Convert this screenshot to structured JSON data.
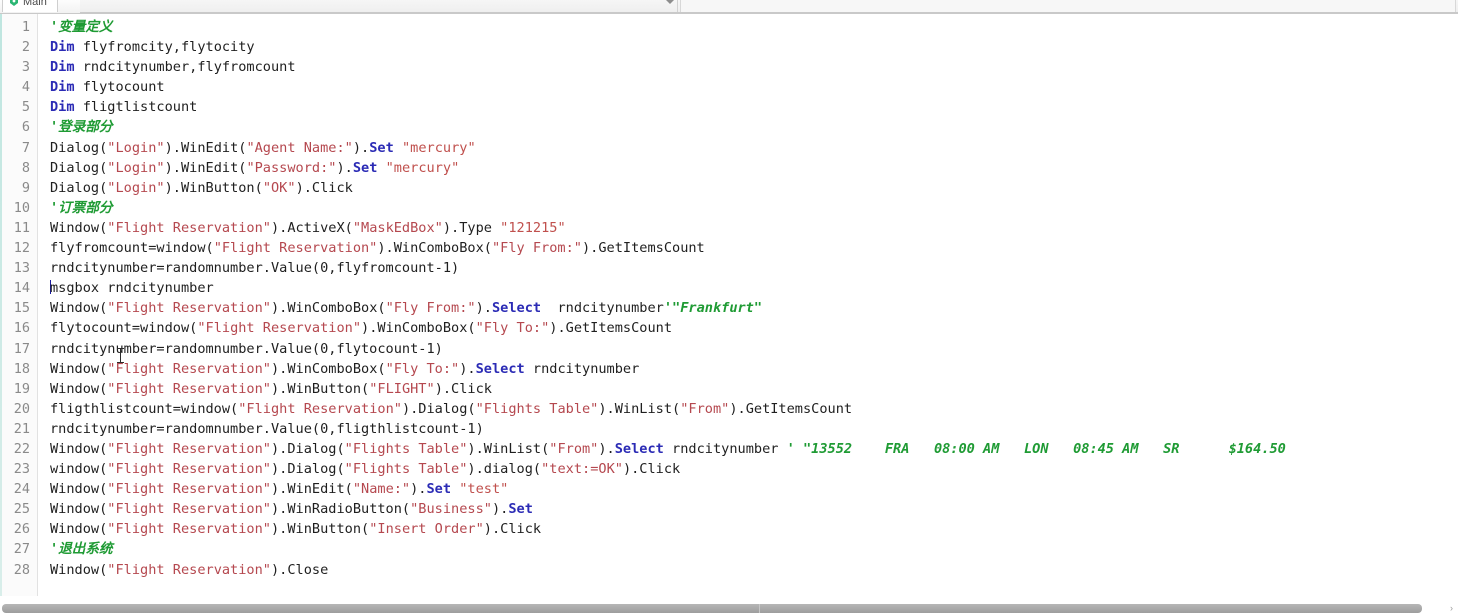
{
  "window": {
    "title": "Main",
    "tab_icon": "script-file-icon"
  },
  "tabs": [
    {
      "label": "Main",
      "active": true
    }
  ],
  "editor": {
    "language": "VBScript",
    "caret_line": 14,
    "colors": {
      "comment": "#1f9b34",
      "keyword": "#2b2bb5",
      "string": "#b5484f",
      "text": "#1f1f1f",
      "gutter_text": "#8a8a8a",
      "background": "#ffffff",
      "gutter_background": "#fbfbfb"
    },
    "line_numbers": [
      1,
      2,
      3,
      4,
      5,
      6,
      7,
      8,
      9,
      10,
      11,
      12,
      13,
      14,
      15,
      16,
      17,
      18,
      19,
      20,
      21,
      22,
      23,
      24,
      25,
      26,
      27,
      28
    ],
    "lines": [
      {
        "n": 1,
        "tokens": [
          {
            "t": "com",
            "v": "'变量定义"
          }
        ]
      },
      {
        "n": 2,
        "tokens": [
          {
            "t": "kw",
            "v": "Dim"
          },
          {
            "t": "id",
            "v": " flyfromcity,flytocity"
          }
        ]
      },
      {
        "n": 3,
        "tokens": [
          {
            "t": "kw",
            "v": "Dim"
          },
          {
            "t": "id",
            "v": " rndcitynumber,flyfromcount"
          }
        ]
      },
      {
        "n": 4,
        "tokens": [
          {
            "t": "kw",
            "v": "Dim"
          },
          {
            "t": "id",
            "v": " flytocount"
          }
        ]
      },
      {
        "n": 5,
        "tokens": [
          {
            "t": "kw",
            "v": "Dim"
          },
          {
            "t": "id",
            "v": " fligtlistcount"
          }
        ]
      },
      {
        "n": 6,
        "tokens": [
          {
            "t": "com",
            "v": "'登录部分"
          }
        ]
      },
      {
        "n": 7,
        "tokens": [
          {
            "t": "id",
            "v": "Dialog("
          },
          {
            "t": "str",
            "v": "\"Login\""
          },
          {
            "t": "id",
            "v": ").WinEdit("
          },
          {
            "t": "str",
            "v": "\"Agent Name:\""
          },
          {
            "t": "id",
            "v": ")."
          },
          {
            "t": "kw",
            "v": "Set"
          },
          {
            "t": "str2",
            "v": " \"mercury\""
          }
        ]
      },
      {
        "n": 8,
        "tokens": [
          {
            "t": "id",
            "v": "Dialog("
          },
          {
            "t": "str",
            "v": "\"Login\""
          },
          {
            "t": "id",
            "v": ").WinEdit("
          },
          {
            "t": "str",
            "v": "\"Password:\""
          },
          {
            "t": "id",
            "v": ")."
          },
          {
            "t": "kw",
            "v": "Set"
          },
          {
            "t": "str2",
            "v": " \"mercury\""
          }
        ]
      },
      {
        "n": 9,
        "tokens": [
          {
            "t": "id",
            "v": "Dialog("
          },
          {
            "t": "str",
            "v": "\"Login\""
          },
          {
            "t": "id",
            "v": ").WinButton("
          },
          {
            "t": "str",
            "v": "\"OK\""
          },
          {
            "t": "id",
            "v": ").Click"
          }
        ]
      },
      {
        "n": 10,
        "tokens": [
          {
            "t": "com",
            "v": "'订票部分"
          }
        ]
      },
      {
        "n": 11,
        "tokens": [
          {
            "t": "id",
            "v": "Window("
          },
          {
            "t": "str",
            "v": "\"Flight Reservation\""
          },
          {
            "t": "id",
            "v": ").ActiveX("
          },
          {
            "t": "str",
            "v": "\"MaskEdBox\""
          },
          {
            "t": "id",
            "v": ").Type "
          },
          {
            "t": "str2",
            "v": "\"121215\""
          }
        ]
      },
      {
        "n": 12,
        "tokens": [
          {
            "t": "id",
            "v": "flyfromcount=window("
          },
          {
            "t": "str",
            "v": "\"Flight Reservation\""
          },
          {
            "t": "id",
            "v": ").WinComboBox("
          },
          {
            "t": "str",
            "v": "\"Fly From:\""
          },
          {
            "t": "id",
            "v": ").GetItemsCount"
          }
        ]
      },
      {
        "n": 13,
        "tokens": [
          {
            "t": "id",
            "v": "rndcitynumber=randomnumber.Value(0,flyfromcount-1)"
          }
        ]
      },
      {
        "n": 14,
        "tokens": [
          {
            "t": "caret",
            "v": ""
          },
          {
            "t": "id",
            "v": "msgbox rndcitynumber"
          }
        ]
      },
      {
        "n": 15,
        "tokens": [
          {
            "t": "id",
            "v": "Window("
          },
          {
            "t": "str",
            "v": "\"Flight Reservation\""
          },
          {
            "t": "id",
            "v": ").WinComboBox("
          },
          {
            "t": "str",
            "v": "\"Fly From:\""
          },
          {
            "t": "id",
            "v": ")."
          },
          {
            "t": "kw",
            "v": "Select"
          },
          {
            "t": "id",
            "v": "  rndcitynumber"
          },
          {
            "t": "com",
            "v": "'\"Frankfurt\""
          }
        ]
      },
      {
        "n": 16,
        "tokens": [
          {
            "t": "id",
            "v": "flytocount=window("
          },
          {
            "t": "str",
            "v": "\"Flight Reservation\""
          },
          {
            "t": "id",
            "v": ").WinComboBox("
          },
          {
            "t": "str",
            "v": "\"Fly To:\""
          },
          {
            "t": "id",
            "v": ").GetItemsCount"
          }
        ]
      },
      {
        "n": 17,
        "tokens": [
          {
            "t": "id",
            "v": "rndcitynumber=randomnumber.Value(0,flytocount-1)"
          }
        ]
      },
      {
        "n": 18,
        "tokens": [
          {
            "t": "id",
            "v": "Window("
          },
          {
            "t": "str",
            "v": "\"Flight Reservation\""
          },
          {
            "t": "id",
            "v": ").WinComboBox("
          },
          {
            "t": "str",
            "v": "\"Fly To:\""
          },
          {
            "t": "id",
            "v": ")."
          },
          {
            "t": "kw",
            "v": "Select"
          },
          {
            "t": "id",
            "v": " rndcitynumber"
          }
        ]
      },
      {
        "n": 19,
        "tokens": [
          {
            "t": "id",
            "v": "Window("
          },
          {
            "t": "str",
            "v": "\"Flight Reservation\""
          },
          {
            "t": "id",
            "v": ").WinButton("
          },
          {
            "t": "str",
            "v": "\"FLIGHT\""
          },
          {
            "t": "id",
            "v": ").Click"
          }
        ]
      },
      {
        "n": 20,
        "tokens": [
          {
            "t": "id",
            "v": "fligthlistcount=window("
          },
          {
            "t": "str",
            "v": "\"Flight Reservation\""
          },
          {
            "t": "id",
            "v": ").Dialog("
          },
          {
            "t": "str",
            "v": "\"Flights Table\""
          },
          {
            "t": "id",
            "v": ").WinList("
          },
          {
            "t": "str",
            "v": "\"From\""
          },
          {
            "t": "id",
            "v": ").GetItemsCount"
          }
        ]
      },
      {
        "n": 21,
        "tokens": [
          {
            "t": "id",
            "v": "rndcitynumber=randomnumber.Value(0,fligthlistcount-1)"
          }
        ]
      },
      {
        "n": 22,
        "tokens": [
          {
            "t": "id",
            "v": "Window("
          },
          {
            "t": "str",
            "v": "\"Flight Reservation\""
          },
          {
            "t": "id",
            "v": ").Dialog("
          },
          {
            "t": "str",
            "v": "\"Flights Table\""
          },
          {
            "t": "id",
            "v": ").WinList("
          },
          {
            "t": "str",
            "v": "\"From\""
          },
          {
            "t": "id",
            "v": ")."
          },
          {
            "t": "kw",
            "v": "Select"
          },
          {
            "t": "id",
            "v": " rndcitynumber "
          },
          {
            "t": "com",
            "v": "' \"13552    FRA   08:00 AM   LON   08:45 AM   SR      $164.50"
          }
        ]
      },
      {
        "n": 23,
        "tokens": [
          {
            "t": "id",
            "v": "window("
          },
          {
            "t": "str",
            "v": "\"Flight Reservation\""
          },
          {
            "t": "id",
            "v": ").Dialog("
          },
          {
            "t": "str",
            "v": "\"Flights Table\""
          },
          {
            "t": "id",
            "v": ").dialog("
          },
          {
            "t": "str",
            "v": "\"text:=OK\""
          },
          {
            "t": "id",
            "v": ").Click"
          }
        ]
      },
      {
        "n": 24,
        "tokens": [
          {
            "t": "id",
            "v": "Window("
          },
          {
            "t": "str",
            "v": "\"Flight Reservation\""
          },
          {
            "t": "id",
            "v": ").WinEdit("
          },
          {
            "t": "str",
            "v": "\"Name:\""
          },
          {
            "t": "id",
            "v": ")."
          },
          {
            "t": "kw",
            "v": "Set"
          },
          {
            "t": "str2",
            "v": " \"test\""
          }
        ]
      },
      {
        "n": 25,
        "tokens": [
          {
            "t": "id",
            "v": "Window("
          },
          {
            "t": "str",
            "v": "\"Flight Reservation\""
          },
          {
            "t": "id",
            "v": ").WinRadioButton("
          },
          {
            "t": "str",
            "v": "\"Business\""
          },
          {
            "t": "id",
            "v": ")."
          },
          {
            "t": "kw",
            "v": "Set"
          }
        ]
      },
      {
        "n": 26,
        "tokens": [
          {
            "t": "id",
            "v": "Window("
          },
          {
            "t": "str",
            "v": "\"Flight Reservation\""
          },
          {
            "t": "id",
            "v": ").WinButton("
          },
          {
            "t": "str",
            "v": "\"Insert Order\""
          },
          {
            "t": "id",
            "v": ").Click"
          }
        ]
      },
      {
        "n": 27,
        "tokens": [
          {
            "t": "com",
            "v": "'退出系统"
          }
        ]
      },
      {
        "n": 28,
        "tokens": [
          {
            "t": "id",
            "v": "Window("
          },
          {
            "t": "str",
            "v": "\"Flight Reservation\""
          },
          {
            "t": "id",
            "v": ").Close"
          }
        ]
      }
    ]
  },
  "scrollbar": {
    "orientation": "horizontal",
    "thumb_fraction": 0.97,
    "right_arrow": "›"
  }
}
